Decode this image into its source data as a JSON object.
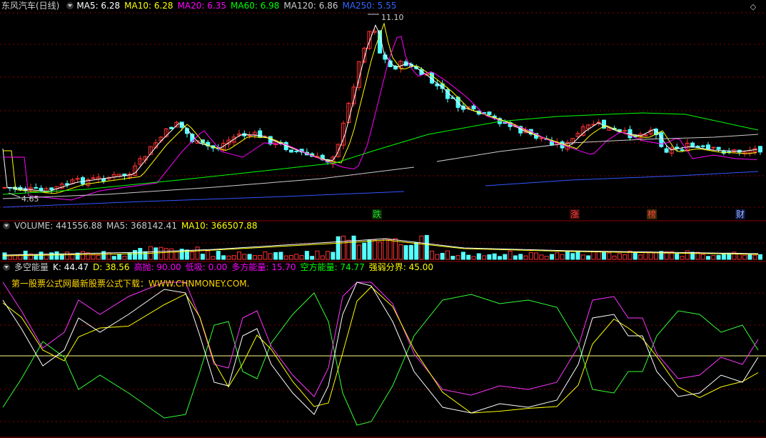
{
  "main": {
    "title": "东风汽车(日线)",
    "ma": [
      {
        "label": "MA5: 6.28",
        "color": "#ffffff"
      },
      {
        "label": "MA10: 6.28",
        "color": "#ffff00"
      },
      {
        "label": "MA20: 6.35",
        "color": "#ff00ff"
      },
      {
        "label": "MA60: 6.98",
        "color": "#00ff00"
      },
      {
        "label": "MA120: 6.86",
        "color": "#cccccc"
      },
      {
        "label": "MA250: 5.55",
        "color": "#3366ff"
      }
    ],
    "high_label": "11.10",
    "low_label": "4.65",
    "markers": [
      {
        "text": "跌",
        "color": "#22dd22",
        "bg": "#0a2a0a"
      },
      {
        "text": "涨",
        "color": "#ff4444",
        "bg": "#3a0a0a"
      },
      {
        "text": "榜",
        "color": "#ff4444",
        "bg": "#3a2a00"
      },
      {
        "text": "财",
        "color": "#9fb8ff",
        "bg": "#0a1640"
      }
    ]
  },
  "volume": {
    "items": [
      {
        "label": "VOLUME: 441556.88",
        "color": "#cccccc"
      },
      {
        "label": "MA5: 368142.41",
        "color": "#cccccc"
      },
      {
        "label": "MA10: 366507.88",
        "color": "#ffff00"
      }
    ]
  },
  "indicator": {
    "items": [
      {
        "label": "多空能量",
        "color": "#cccccc"
      },
      {
        "label": "K: 44.47",
        "color": "#ffffff"
      },
      {
        "label": "D: 38.56",
        "color": "#ffff00"
      },
      {
        "label": "高抛: 90.00",
        "color": "#ff00ff"
      },
      {
        "label": "低吸: 0.00",
        "color": "#ff00ff"
      },
      {
        "label": "多方能量: 15.70",
        "color": "#ff00ff"
      },
      {
        "label": "空方能量: 74.77",
        "color": "#00ff00"
      },
      {
        "label": "强弱分界: 45.00",
        "color": "#ffff00"
      }
    ],
    "promo": "第一股票公式网最新股票公式下载：WWW.CHNMONEY.COM."
  },
  "colors": {
    "up": "#ff3232",
    "down": "#54ffff",
    "grid": "#8b0000"
  }
}
